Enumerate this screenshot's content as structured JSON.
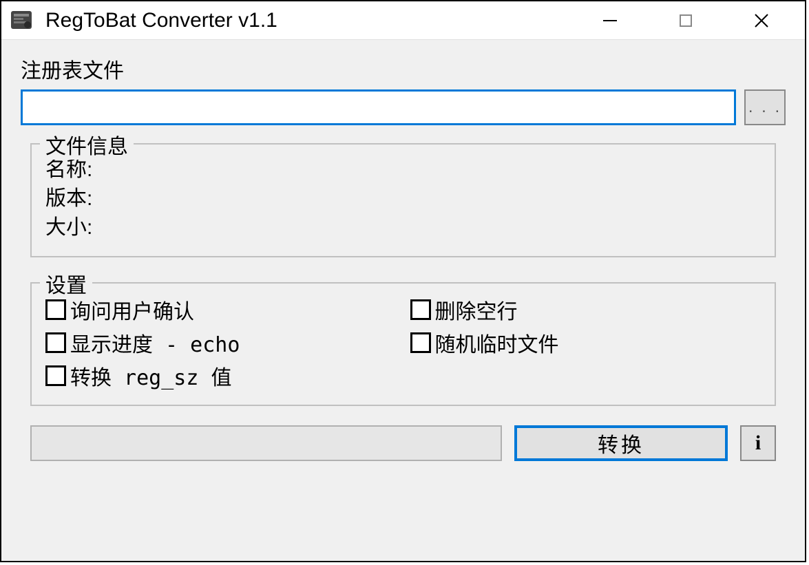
{
  "titlebar": {
    "title": "RegToBat Converter v1.1"
  },
  "file": {
    "label": "注册表文件",
    "input_value": "",
    "browse_label": ". . ."
  },
  "fileinfo": {
    "group_title": "文件信息",
    "name_label": "名称:",
    "version_label": "版本:",
    "size_label": "大小:",
    "name_value": "",
    "version_value": "",
    "size_value": ""
  },
  "settings": {
    "group_title": "设置",
    "ask_confirm": "询问用户确认",
    "delete_blank": "删除空行",
    "show_echo": "显示进度 - echo",
    "random_temp": "随机临时文件",
    "convert_regsz": "转换 reg_sz 值"
  },
  "bottom": {
    "convert_label": "转换",
    "info_label": "i"
  }
}
